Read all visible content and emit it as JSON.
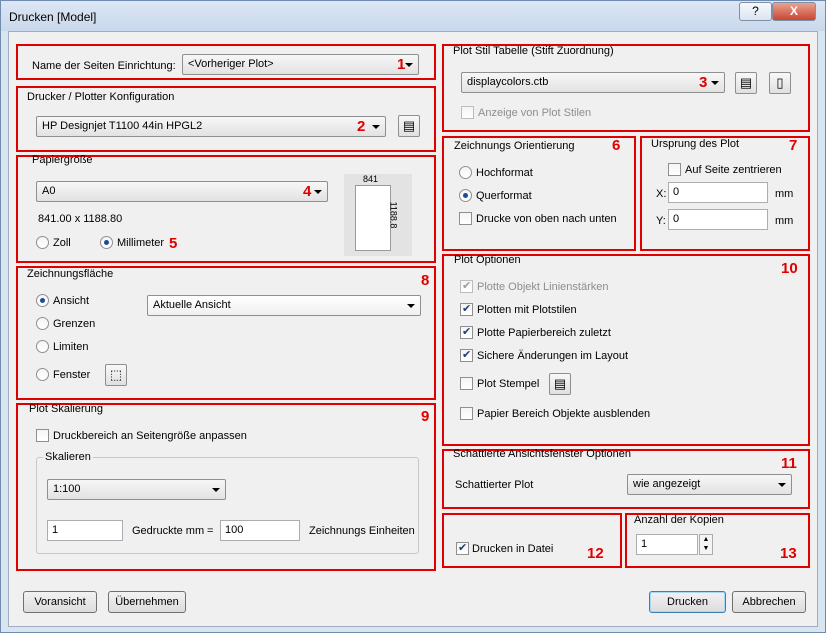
{
  "window": {
    "title": "Drucken [Model]",
    "help_label": "?",
    "close_label": "X"
  },
  "page_setup": {
    "label": "Name der Seiten Einrichtung:",
    "value": "<Vorheriger Plot>",
    "marker": "1"
  },
  "plotter": {
    "group_title": "Drucker / Plotter Konfiguration",
    "value": "HP Designjet T1100 44in HPGL2",
    "marker": "2"
  },
  "paper": {
    "group_title": "Papiergröße",
    "value": "A0",
    "marker": "4",
    "dimensions": "841.00 x 1188.80",
    "unit_inch": "Zoll",
    "unit_mm": "Millimeter",
    "unit_marker": "5",
    "preview_width": "841",
    "preview_height": "1188.8",
    "selected_unit": "Millimeter"
  },
  "area": {
    "group_title": "Zeichnungsfläche",
    "marker": "8",
    "options": [
      "Ansicht",
      "Grenzen",
      "Limiten",
      "Fenster"
    ],
    "selected": "Ansicht",
    "view_value": "Aktuelle Ansicht"
  },
  "scale": {
    "group_title": "Plot Skalierung",
    "marker": "9",
    "fit_label": "Druckbereich an Seitengröße anpassen",
    "fit_checked": false,
    "sub_title": "Skalieren",
    "value": "1:100",
    "mm_value": "1",
    "mm_label": "Gedruckte mm",
    "equals": "=",
    "units_value": "100",
    "units_label": "Zeichnungs Einheiten"
  },
  "style_table": {
    "group_title": "Plot Stil Tabelle (Stift Zuordnung)",
    "value": "displaycolors.ctb",
    "marker": "3",
    "show_styles_label": "Anzeige von Plot Stilen",
    "show_styles_checked": false
  },
  "orientation": {
    "group_title": "Zeichnungs Orientierung",
    "marker": "6",
    "portrait": "Hochformat",
    "landscape": "Querformat",
    "upside_down": "Drucke von oben nach unten",
    "selected": "Querformat",
    "upside_down_checked": false
  },
  "offset": {
    "group_title": "Ursprung des Plot",
    "marker": "7",
    "center_label": "Auf Seite zentrieren",
    "center_checked": false,
    "x_label": "X:",
    "x_value": "0",
    "y_label": "Y:",
    "y_value": "0",
    "unit": "mm"
  },
  "plot_options": {
    "group_title": "Plot Optionen",
    "marker": "10",
    "items": [
      {
        "label": "Plotte Objekt Linienstärken",
        "checked": true,
        "disabled": true
      },
      {
        "label": "Plotten mit Plotstilen",
        "checked": true,
        "disabled": false
      },
      {
        "label": "Plotte Papierbereich zuletzt",
        "checked": true,
        "disabled": false
      },
      {
        "label": "Sichere Änderungen im Layout",
        "checked": true,
        "disabled": false
      },
      {
        "label": "Plot Stempel",
        "checked": false,
        "disabled": false
      },
      {
        "label": "Papier Bereich Objekte ausblenden",
        "checked": false,
        "disabled": false
      }
    ]
  },
  "shaded": {
    "group_title": "Schattierte Ansichtsfenster Optionen",
    "marker": "11",
    "label": "Schattierter Plot",
    "value": "wie angezeigt"
  },
  "to_file": {
    "label": "Drucken in Datei",
    "checked": true,
    "marker": "12"
  },
  "copies": {
    "group_title": "Anzahl der Kopien",
    "value": "1",
    "marker": "13"
  },
  "buttons": {
    "preview": "Voransicht",
    "apply": "Übernehmen",
    "print": "Drucken",
    "cancel": "Abbrechen"
  }
}
